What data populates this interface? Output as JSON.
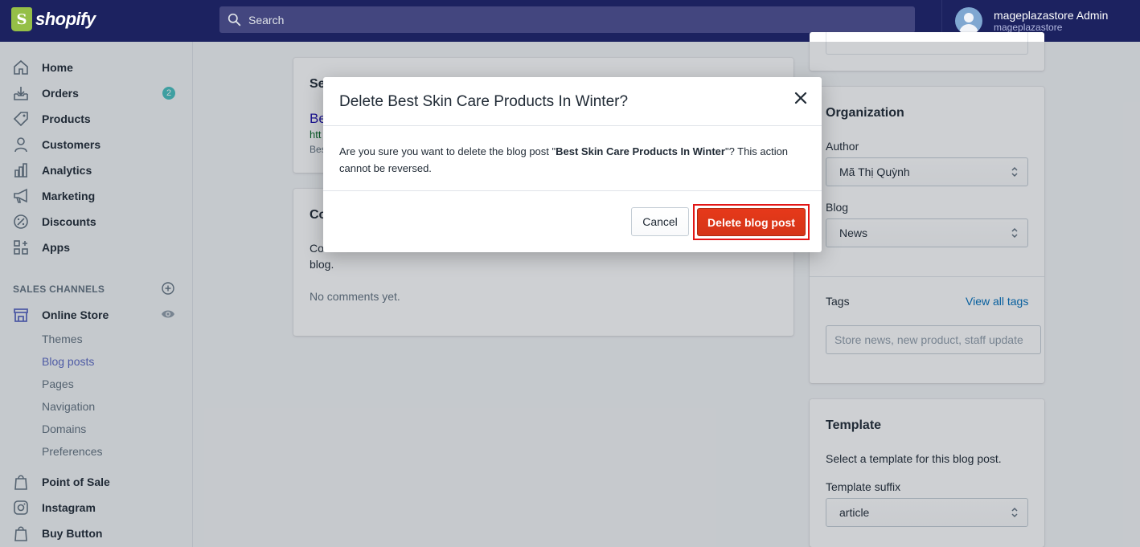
{
  "topbar": {
    "brand": "shopify",
    "search_placeholder": "Search",
    "user_name": "mageplazastore Admin",
    "user_store": "mageplazastore"
  },
  "sidebar": {
    "items": [
      {
        "label": "Home",
        "icon": "home-icon"
      },
      {
        "label": "Orders",
        "icon": "orders-icon",
        "badge": "2"
      },
      {
        "label": "Products",
        "icon": "tag-icon"
      },
      {
        "label": "Customers",
        "icon": "person-icon"
      },
      {
        "label": "Analytics",
        "icon": "bar-chart-icon"
      },
      {
        "label": "Marketing",
        "icon": "megaphone-icon"
      },
      {
        "label": "Discounts",
        "icon": "discount-icon"
      },
      {
        "label": "Apps",
        "icon": "apps-icon"
      }
    ],
    "sales_channels_title": "SALES CHANNELS",
    "online_store": "Online Store",
    "sub_items": [
      "Themes",
      "Blog posts",
      "Pages",
      "Navigation",
      "Domains",
      "Preferences"
    ],
    "active_sub_item": "Blog posts",
    "channels": [
      "Point of Sale",
      "Instagram",
      "Buy Button"
    ]
  },
  "page": {
    "seo_title_fragment": "Se",
    "seo_link_fragment": "Be",
    "seo_url_fragment": "htt",
    "seo_desc_fragment": "Bes",
    "comments_title_fragment": "Co",
    "comments_text_start": "Co",
    "comments_text_end": "blog.",
    "no_comments": "No comments yet.",
    "organization_title": "Organization",
    "author_label": "Author",
    "author_value": "Mã Thị Quỳnh",
    "blog_label": "Blog",
    "blog_value": "News",
    "tags_label": "Tags",
    "view_all_tags": "View all tags",
    "tags_placeholder": "Store news, new product, staff update",
    "template_title": "Template",
    "template_desc": "Select a template for this blog post.",
    "template_suffix_label": "Template suffix",
    "template_suffix_value": "article"
  },
  "modal": {
    "title": "Delete Best Skin Care Products In Winter?",
    "body_prefix": "Are you sure you want to delete the blog post \"",
    "body_post_name": "Best Skin Care Products In Winter",
    "body_suffix": "\"? This action cannot be reversed.",
    "cancel_label": "Cancel",
    "delete_label": "Delete blog post"
  },
  "colors": {
    "topbar": "#1c2260",
    "accent": "#5c6ac4",
    "delete": "#de3618",
    "highlight": "#e21515",
    "badge": "#47c1bf",
    "brand": "#95bf47"
  }
}
